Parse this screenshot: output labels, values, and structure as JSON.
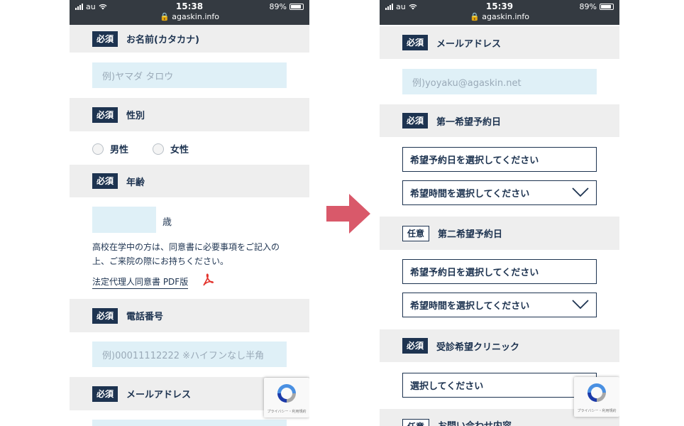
{
  "left": {
    "status": {
      "carrier": "au",
      "time": "15:38",
      "url": "agaskin.info",
      "battery": "89%"
    },
    "name_section": {
      "badge": "必須",
      "label": "お名前(カタカナ)"
    },
    "name_input": {
      "placeholder": "例)ヤマダ タロウ"
    },
    "gender_section": {
      "badge": "必須",
      "label": "性別"
    },
    "gender_options": [
      "男性",
      "女性"
    ],
    "age_section": {
      "badge": "必須",
      "label": "年齢"
    },
    "age_unit": "歳",
    "age_note_line1": "高校在学中の方は、同意書に必要事項をご記入の",
    "age_note_line2": "上、ご来院の際にお持ちください。",
    "consent_link": "法定代理人同意書 PDF版",
    "phone_section": {
      "badge": "必須",
      "label": "電話番号"
    },
    "phone_input": {
      "placeholder": "例)00011112222 ※ハイフンなし半角"
    },
    "email_section": {
      "badge": "必須",
      "label": "メールアドレス"
    },
    "recaptcha_text": "プライバシー・利用規約"
  },
  "right": {
    "status": {
      "carrier": "au",
      "time": "15:39",
      "url": "agaskin.info",
      "battery": "89%"
    },
    "email_section": {
      "badge": "必須",
      "label": "メールアドレス"
    },
    "email_input": {
      "placeholder": "例)yoyaku@agaskin.net"
    },
    "first_choice_section": {
      "badge": "必須",
      "label": "第一希望予約日"
    },
    "first_date_select": "希望予約日を選択してください",
    "first_time_select": "希望時間を選択してください",
    "second_choice_section": {
      "badge": "任意",
      "label": "第二希望予約日"
    },
    "second_date_select": "希望予約日を選択してください",
    "second_time_select": "希望時間を選択してください",
    "clinic_section": {
      "badge": "必須",
      "label": "受診希望クリニック"
    },
    "clinic_select": "選択してください",
    "inquiry_section": {
      "badge": "任意",
      "label": "お問い合わせ内容"
    },
    "recaptcha_text": "プライバシー・利用規約"
  },
  "colors": {
    "navy": "#1d3350",
    "input_bg": "#dff0f7",
    "section_bg": "#eeeeee",
    "arrow": "#d9596a",
    "statusbar": "#343a41"
  }
}
